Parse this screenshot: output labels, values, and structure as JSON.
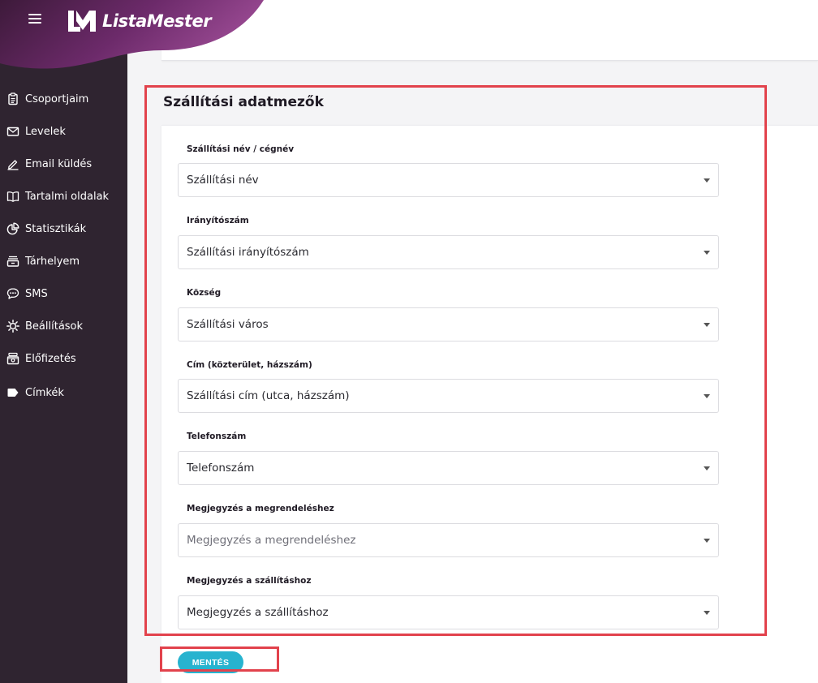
{
  "brand": {
    "name": "ListaMester",
    "logo_mark": "LM-logo-icon",
    "accent": "#6c2a6a"
  },
  "sidebar": {
    "items": [
      {
        "label": "Csoportjaim",
        "icon": "clipboard-icon"
      },
      {
        "label": "Levelek",
        "icon": "envelope-icon"
      },
      {
        "label": "Email küldés",
        "icon": "pencil-icon"
      },
      {
        "label": "Tartalmi oldalak",
        "icon": "book-icon"
      },
      {
        "label": "Statisztikák",
        "icon": "pie-chart-icon"
      },
      {
        "label": "Tárhelyem",
        "icon": "archive-icon"
      },
      {
        "label": "SMS",
        "icon": "chat-bubble-icon"
      },
      {
        "label": "Beállítások",
        "icon": "gear-icon"
      },
      {
        "label": "Előfizetés",
        "icon": "cash-register-icon"
      },
      {
        "label": "Címkék",
        "icon": "tag-icon"
      }
    ]
  },
  "section": {
    "title": "Szállítási adatmezők",
    "fields": [
      {
        "label": "Szállítási név / cégnév",
        "value": "Szállítási név",
        "placeholder": false
      },
      {
        "label": "Irányítószám",
        "value": "Szállítási irányítószám",
        "placeholder": false
      },
      {
        "label": "Község",
        "value": "Szállítási város",
        "placeholder": false
      },
      {
        "label": "Cím (közterület, házszám)",
        "value": "Szállítási cím (utca, házszám)",
        "placeholder": false
      },
      {
        "label": "Telefonszám",
        "value": "Telefonszám",
        "placeholder": false
      },
      {
        "label": "Megjegyzés a megrendeléshez",
        "value": "Megjegyzés a megrendeléshez",
        "placeholder": true
      },
      {
        "label": "Megjegyzés a szállításhoz",
        "value": "Megjegyzés a szállításhoz",
        "placeholder": false
      }
    ]
  },
  "actions": {
    "save_label": "MENTÉS",
    "save_color": "#27b3cf"
  },
  "annotation_color": "#e2424c"
}
